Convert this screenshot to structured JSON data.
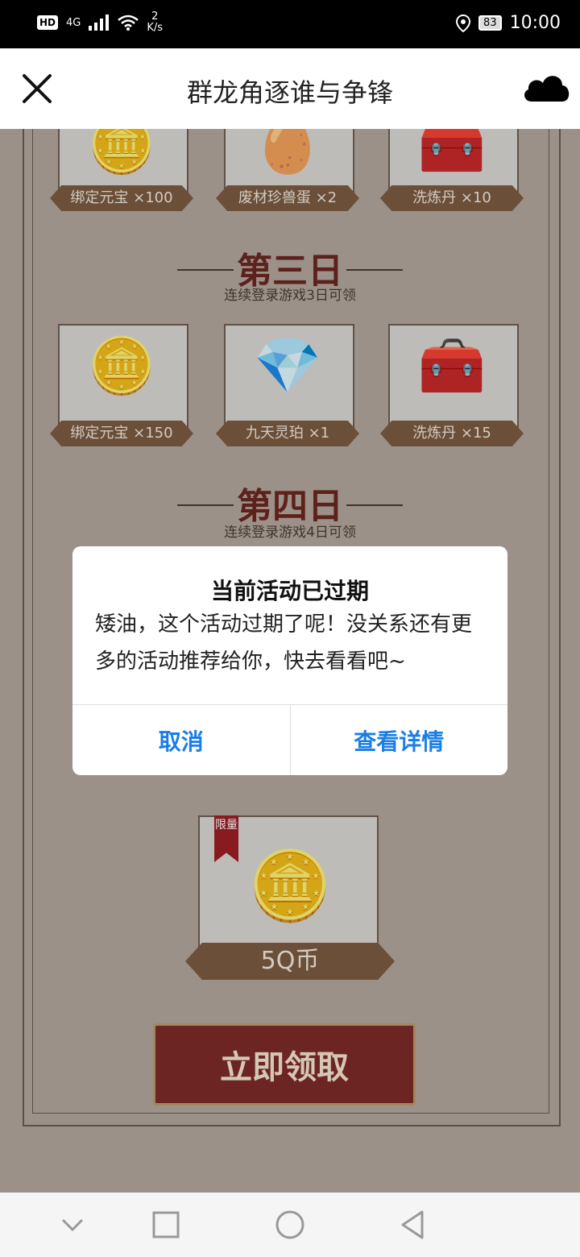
{
  "status": {
    "hd": "HD",
    "network": "4G",
    "speed_value": "2",
    "speed_unit": "K/s",
    "battery": "83",
    "time": "10:00"
  },
  "header": {
    "title": "群龙角逐谁与争锋"
  },
  "rewards_row_top": [
    {
      "label": "绑定元宝 ×100",
      "icon": "gold-ingot-icon"
    },
    {
      "label": "废材珍兽蛋 ×2",
      "icon": "pet-egg-icon"
    },
    {
      "label": "洗炼丹 ×10",
      "icon": "treasure-chest-icon"
    }
  ],
  "day3": {
    "title": "第三日",
    "subtitle": "连续登录游戏3日可领",
    "rewards": [
      {
        "label": "绑定元宝 ×150",
        "icon": "gold-ingot-icon"
      },
      {
        "label": "九天灵珀 ×1",
        "icon": "crystal-icon"
      },
      {
        "label": "洗炼丹 ×15",
        "icon": "treasure-chest-icon"
      }
    ]
  },
  "day4": {
    "title": "第四日",
    "subtitle": "连续登录游戏4日可领"
  },
  "big_reward": {
    "badge": "限量",
    "label": "5Q币",
    "icon": "coins-icon"
  },
  "claim_button": "立即领取",
  "dialog": {
    "title": "当前活动已过期",
    "message": "矮油，这个活动过期了呢！没关系还有更多的活动推荐给你，快去看看吧~",
    "cancel": "取消",
    "details": "查看详情"
  },
  "colors": {
    "accent": "#1a7ee6",
    "day_title": "#6a261f",
    "label_bg": "#7a5b41"
  }
}
